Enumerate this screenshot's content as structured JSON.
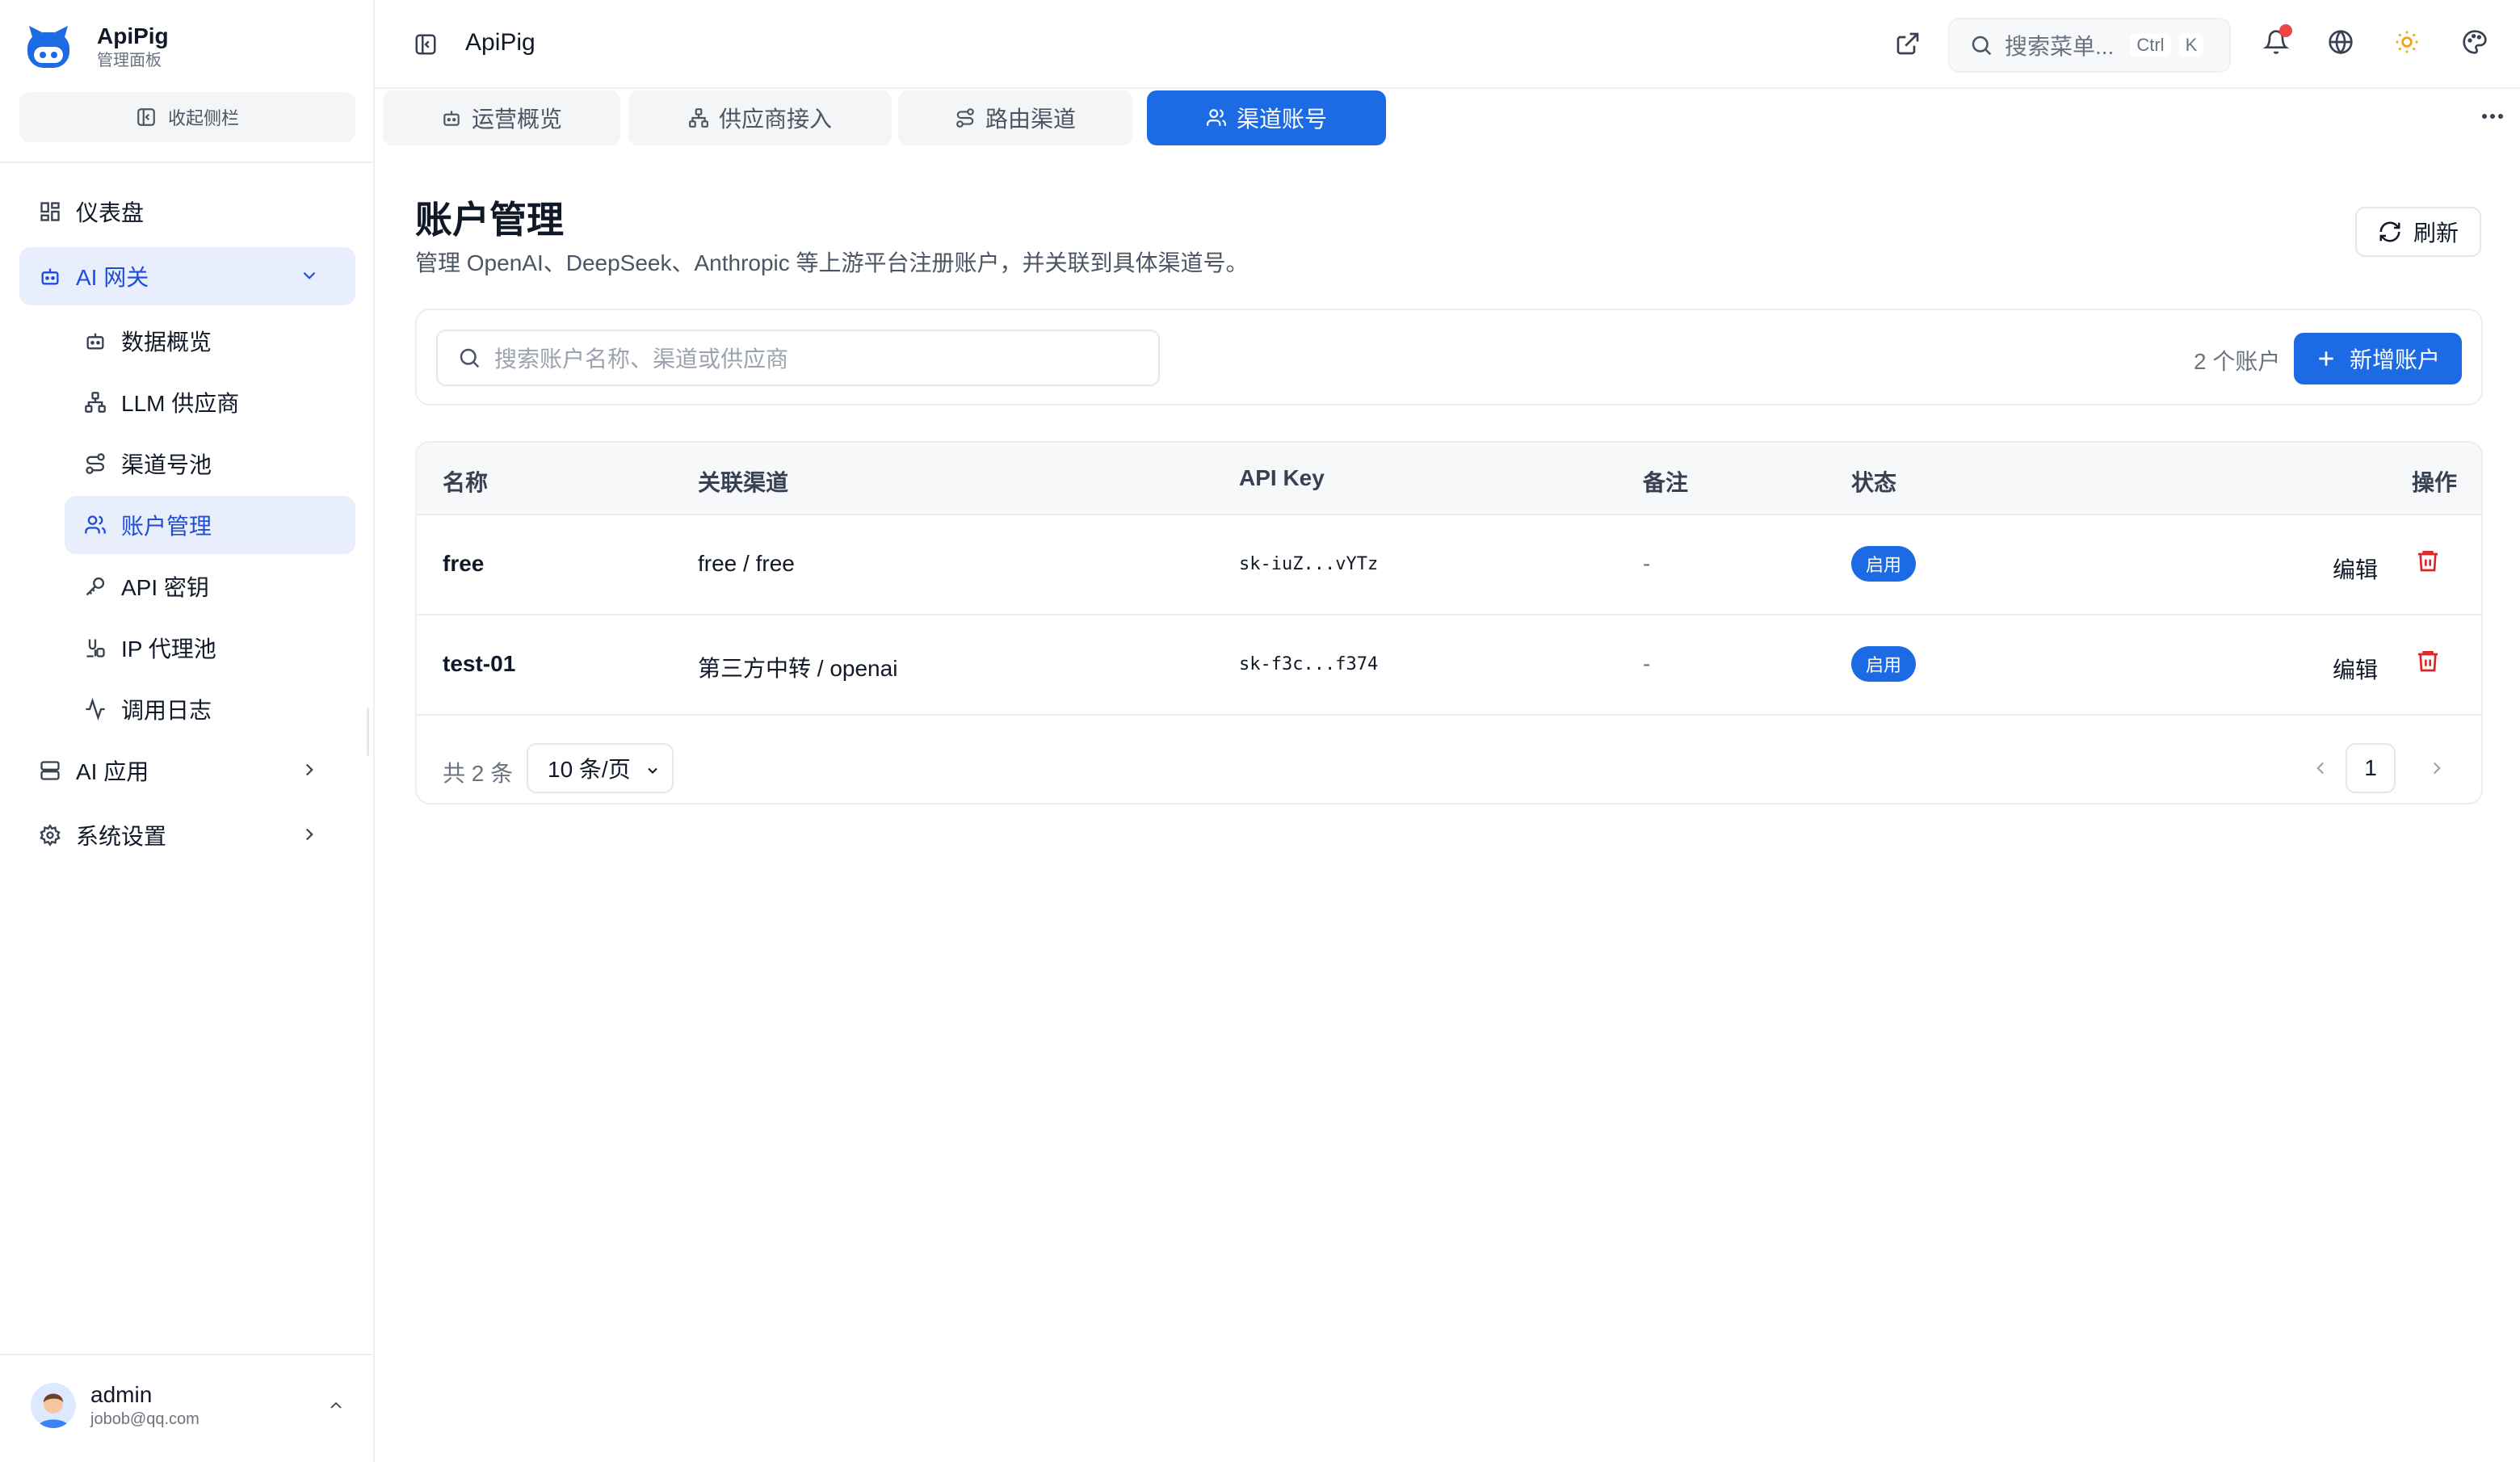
{
  "brand": {
    "name": "ApiPig",
    "subtitle": "管理面板"
  },
  "sidebar": {
    "collapse_label": "收起侧栏",
    "items": [
      {
        "label": "仪表盘",
        "icon": "dashboard-icon"
      },
      {
        "label": "AI 网关",
        "icon": "robot-icon",
        "expanded": true
      },
      {
        "label": "AI 应用",
        "icon": "server-icon"
      },
      {
        "label": "系统设置",
        "icon": "gear-icon"
      }
    ],
    "sub_items": [
      {
        "label": "数据概览",
        "icon": "robot-icon"
      },
      {
        "label": "LLM 供应商",
        "icon": "network-icon"
      },
      {
        "label": "渠道号池",
        "icon": "route-icon"
      },
      {
        "label": "账户管理",
        "icon": "users-icon",
        "active": true
      },
      {
        "label": "API 密钥",
        "icon": "key-icon"
      },
      {
        "label": "IP 代理池",
        "icon": "proxy-icon"
      },
      {
        "label": "调用日志",
        "icon": "activity-icon"
      }
    ]
  },
  "user": {
    "name": "admin",
    "email": "jobob@qq.com"
  },
  "header": {
    "title": "ApiPig",
    "search_placeholder": "搜索菜单...",
    "shortcut_ctrl": "Ctrl",
    "shortcut_key": "K"
  },
  "tabs": [
    {
      "label": "运营概览",
      "icon": "robot-icon"
    },
    {
      "label": "供应商接入",
      "icon": "network-icon"
    },
    {
      "label": "路由渠道",
      "icon": "route-icon"
    },
    {
      "label": "渠道账号",
      "icon": "users-icon",
      "active": true
    }
  ],
  "page": {
    "title": "账户管理",
    "subtitle": "管理 OpenAI、DeepSeek、Anthropic 等上游平台注册账户，并关联到具体渠道号。",
    "refresh_label": "刷新",
    "search_placeholder": "搜索账户名称、渠道或供应商",
    "count_label": "2 个账户",
    "add_label": "新增账户"
  },
  "table": {
    "headers": {
      "name": "名称",
      "channel": "关联渠道",
      "api_key": "API Key",
      "note": "备注",
      "status": "状态",
      "actions": "操作"
    },
    "rows": [
      {
        "name": "free",
        "channel": "free / free",
        "api_key": "sk-iuZ...vYTz",
        "note": "-",
        "status": "启用",
        "edit": "编辑"
      },
      {
        "name": "test-01",
        "channel": "第三方中转 / openai",
        "api_key": "sk-f3c...f374",
        "note": "-",
        "status": "启用",
        "edit": "编辑"
      }
    ],
    "total_label": "共 2 条",
    "page_size": "10 条/页",
    "current_page": "1"
  },
  "colors": {
    "primary": "#1d6ae5",
    "active_bg": "#e8eefb",
    "danger": "#dc2626",
    "notification": "#ef4444",
    "sun": "#f59e0b"
  }
}
